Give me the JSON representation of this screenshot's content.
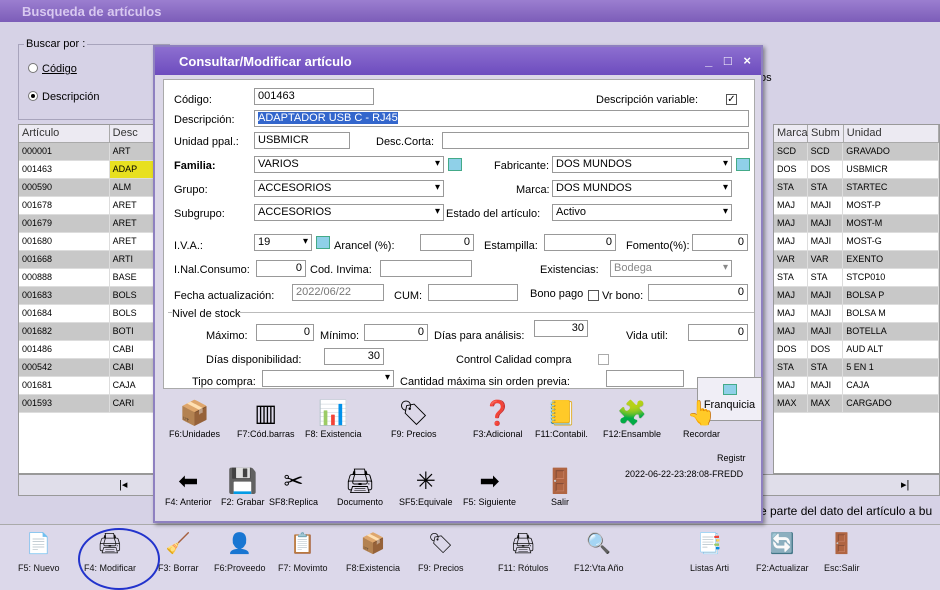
{
  "app": {
    "title": "Busqueda de artículos"
  },
  "search": {
    "label": "Buscar por :",
    "opt_codigo": "Código",
    "opt_descripcion": "Descripción",
    "partial": "os"
  },
  "left_grid": {
    "headers": [
      "Artículo",
      "Desc"
    ],
    "rows": [
      [
        "000001",
        "ART"
      ],
      [
        "001463",
        "ADAP"
      ],
      [
        "000590",
        "ALM"
      ],
      [
        "001678",
        "ARET"
      ],
      [
        "001679",
        "ARET"
      ],
      [
        "001680",
        "ARET"
      ],
      [
        "001668",
        "ARTI"
      ],
      [
        "000888",
        "BASE"
      ],
      [
        "001683",
        "BOLS"
      ],
      [
        "001684",
        "BOLS"
      ],
      [
        "001682",
        "BOTI"
      ],
      [
        "001486",
        "CABI"
      ],
      [
        "000542",
        "CABI"
      ],
      [
        "001681",
        "CAJA"
      ],
      [
        "001593",
        "CARI"
      ]
    ]
  },
  "right_grid": {
    "headers": [
      "Marca",
      "Subm",
      "Unidad"
    ],
    "rows": [
      [
        "SCD",
        "SCD",
        "GRAVADO"
      ],
      [
        "DOS",
        "DOS",
        "USBMICR"
      ],
      [
        "STA",
        "STA",
        "STARTEC"
      ],
      [
        "MAJ",
        "MAJI",
        "MOST-P"
      ],
      [
        "MAJ",
        "MAJI",
        "MOST-M"
      ],
      [
        "MAJ",
        "MAJI",
        "MOST-G"
      ],
      [
        "VAR",
        "VAR",
        "EXENTO"
      ],
      [
        "STA",
        "STA",
        "STCP010"
      ],
      [
        "MAJ",
        "MAJI",
        "BOLSA P"
      ],
      [
        "MAJ",
        "MAJI",
        "BOLSA M"
      ],
      [
        "MAJ",
        "MAJI",
        "BOTELLA"
      ],
      [
        "DOS",
        "DOS",
        "AUD ALT"
      ],
      [
        "STA",
        "STA",
        "5 EN 1"
      ],
      [
        "MAJ",
        "MAJI",
        "CAJA"
      ],
      [
        "MAX",
        "MAX",
        "CARGADO"
      ]
    ]
  },
  "status_hint": "e parte del dato del artículo a bu",
  "dialog": {
    "title": "Consultar/Modificar artículo",
    "controls": "_ □ ×",
    "codigo_lbl": "Código:",
    "codigo": "001463",
    "descvar_lbl": "Descripción variable:",
    "descvar_check": "✓",
    "descripcion_lbl": "Descripción:",
    "descripcion": "ADAPTADOR USB C - RJ45",
    "unidad_lbl": "Unidad ppal.:",
    "unidad": "USBMICR",
    "desccorta_lbl": "Desc.Corta:",
    "desccorta": "",
    "familia_lbl": "Familia:",
    "familia": "VARIOS",
    "fabricante_lbl": "Fabricante:",
    "fabricante": "DOS MUNDOS",
    "grupo_lbl": "Grupo:",
    "grupo": "ACCESORIOS",
    "marca_lbl": "Marca:",
    "marca": "DOS MUNDOS",
    "subgrupo_lbl": "Subgrupo:",
    "subgrupo": "ACCESORIOS",
    "estado_lbl": "Estado del artículo:",
    "estado": "Activo",
    "iva_lbl": "I.V.A.:",
    "iva": "19",
    "arancel_lbl": "Arancel (%):",
    "arancel": "0",
    "estampilla_lbl": "Estampilla:",
    "estampilla": "0",
    "fomento_lbl": "Fomento(%):",
    "fomento": "0",
    "inal_lbl": "I.Nal.Consumo:",
    "inal": "0",
    "invima_lbl": "Cod. Invima:",
    "invima": "",
    "existencias_lbl": "Existencias:",
    "existencias": "Bodega",
    "fecha_lbl": "Fecha actualización:",
    "fecha": "2022/06/22",
    "cum_lbl": "CUM:",
    "cum": "",
    "bonopago_lbl": "Bono pago",
    "vrbono_lbl": "Vr bono:",
    "vrbono": "0",
    "nivel_lbl": "Nivel de stock",
    "maximo_lbl": "Máximo:",
    "maximo": "0",
    "minimo_lbl": "Mínimo:",
    "minimo": "0",
    "dias_analisis_lbl": "Días para análisis:",
    "dias_analisis": "30",
    "vidautil_lbl": "Vida util:",
    "vidautil": "0",
    "dias_disp_lbl": "Días disponibilidad:",
    "dias_disp": "30",
    "calidad_lbl": "Control Calidad compra",
    "tipocompra_lbl": "Tipo compra:",
    "tipocompra": "",
    "cantmax_lbl": "Cantidad máxima sin orden previa:",
    "cantmax": "",
    "franquicia_lbl": "Franquicia",
    "fbtns": [
      "F6:Unidades",
      "F7:Cód.barras",
      "F8: Existencia",
      "F9: Precios",
      "F3:Adicional",
      "F11:Contabil.",
      "F12:Ensamble",
      "Recordar"
    ],
    "nbtns": [
      "F4: Anterior",
      "F2: Grabar",
      "SF8:Replica",
      "Documento",
      "SF5:Equivale",
      "F5: Siguiente",
      "Salir"
    ],
    "registro_lbl": "Registr",
    "registro": "2022-06-22-23:28:08-FREDD"
  },
  "bottom": [
    "F5: Nuevo",
    "F4: Modificar",
    "F3: Borrar",
    "F6:Proveedo",
    "F7: Movimto",
    "F8:Existencia",
    "F9: Precios",
    "F11: Rótulos",
    "F12:Vta Año",
    "Listas Arti",
    "F2:Actualizar",
    "Esc:Salir"
  ],
  "colors": {
    "title": "#7c5db8",
    "dialog_title": "#6d4cbe",
    "highlight": "#3366cc",
    "circle": "#2233cc"
  }
}
